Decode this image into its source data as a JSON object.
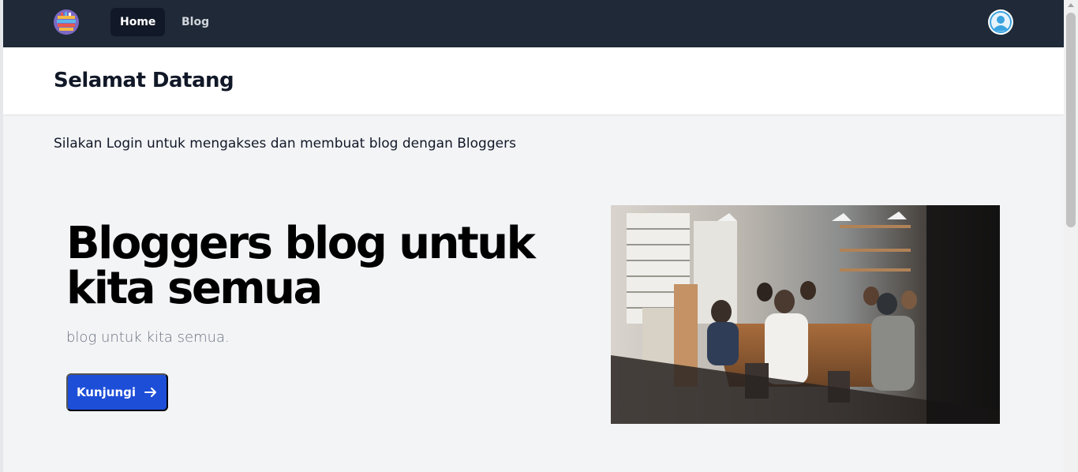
{
  "nav": {
    "logo_icon": "books-logo-icon",
    "links": [
      {
        "label": "Home",
        "active": true
      },
      {
        "label": "Blog",
        "active": false
      }
    ],
    "avatar_icon": "user-avatar-icon"
  },
  "header": {
    "title": "Selamat Datang"
  },
  "main": {
    "intro": "Silakan Login untuk mengakses dan membuat blog dengan Bloggers",
    "hero": {
      "title": "Bloggers blog untuk kita semua",
      "subtitle": "blog untuk kita semua.",
      "button_label": "Kunjungi",
      "button_icon": "arrow-right-icon",
      "image_subject": "people-at-table-photo"
    }
  },
  "colors": {
    "navbar": "#1f2937",
    "nav_active": "#111827",
    "button": "#1d4ed8",
    "background": "#f3f4f6"
  }
}
